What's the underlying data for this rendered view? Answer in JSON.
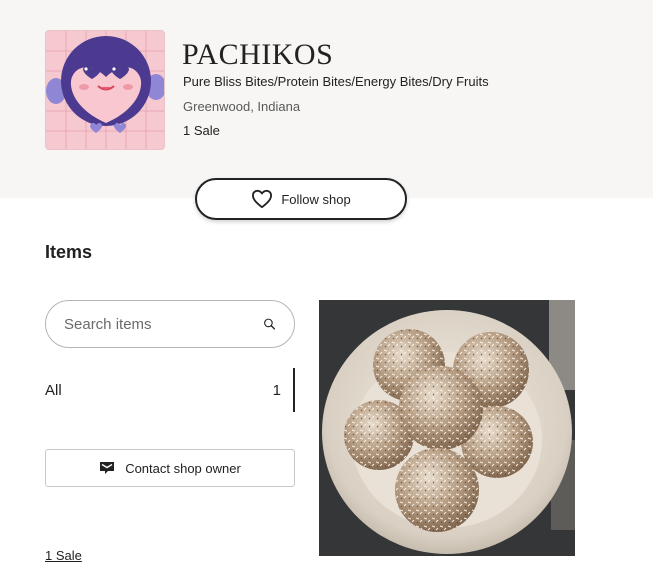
{
  "shop": {
    "name": "PACHIKOS",
    "tagline": "Pure Bliss Bites/Protein Bites/Energy Bites/Dry Fruits",
    "location": "Greenwood, Indiana",
    "sales": "1 Sale",
    "follow_label": "Follow shop",
    "logo_icon": "penguin-logo"
  },
  "items": {
    "heading": "Items",
    "search_placeholder": "Search items",
    "categories": [
      {
        "label": "All",
        "count": "1"
      }
    ],
    "contact_label": "Contact shop owner",
    "sales_link": "1 Sale"
  },
  "listing": {
    "image_icon": "energy-bites-photo"
  },
  "colors": {
    "header_background": "#f7f6f5",
    "text": "#222222",
    "logo_background": "#f6c9d0",
    "logo_accent": "#4b3a8f"
  }
}
